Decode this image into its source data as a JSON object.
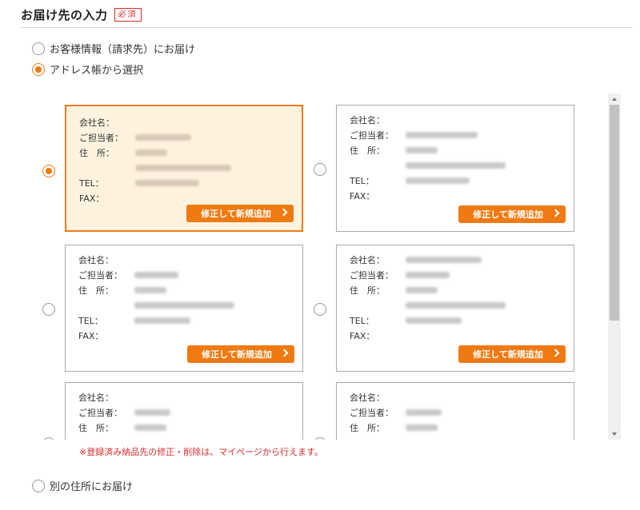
{
  "section": {
    "title": "お届け先の入力",
    "required_badge": "必須"
  },
  "options": {
    "customer": "お客様情報（請求先）にお届け",
    "address_book": "アドレス帳から選択",
    "other": "別の住所にお届け"
  },
  "field_labels": {
    "company": "会社名：",
    "contact": "ご担当者：",
    "address": "住　所：",
    "tel": "TEL：",
    "fax": "FAX："
  },
  "edit_button_label": "修正して新規追加",
  "notice": "※登録済み納品先の修正・削除は、マイページから行えます。",
  "accent_color": "#f07a12",
  "selected_card_index": 0
}
